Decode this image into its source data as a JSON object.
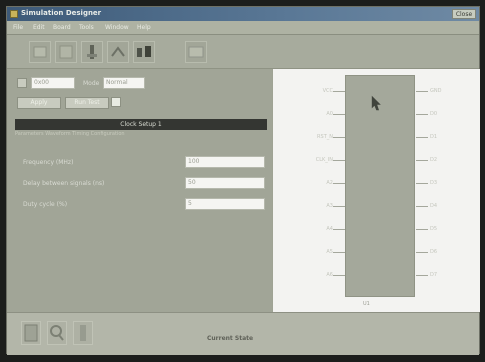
{
  "window": {
    "title": "Simulation Designer",
    "close_label": "Close"
  },
  "menu": [
    "File",
    "Edit",
    "Board",
    "Tools",
    "Window",
    "Help"
  ],
  "toolbar": {
    "buttons": [
      "open-icon",
      "save-icon",
      "probe-icon",
      "chip-icon",
      "waveform-icon",
      "meter-icon"
    ]
  },
  "controls": {
    "port_value": "0x00",
    "mode_label": "Mode",
    "mode_value": "Normal",
    "apply_label": "Apply",
    "run_label": "Run Test"
  },
  "section": {
    "title": "Clock Setup 1",
    "subtitle": "Parameters  Waveform  Timing  Configuration"
  },
  "fields": [
    {
      "label": "Frequency (MHz)",
      "value": "100"
    },
    {
      "label": "Delay between signals (ns)",
      "value": "50"
    },
    {
      "label": "Duty cycle (%)",
      "value": "5"
    }
  ],
  "chip": {
    "name": "U1",
    "left_pins": [
      "VCC",
      "A0",
      "RST_N",
      "CLK_IN",
      "A2",
      "A3",
      "A4",
      "A5",
      "A6"
    ],
    "right_pins": [
      "GND",
      "D0",
      "D1",
      "D2",
      "D3",
      "D4",
      "D5",
      "D6",
      "D7"
    ]
  },
  "status": {
    "text": "Current State"
  }
}
